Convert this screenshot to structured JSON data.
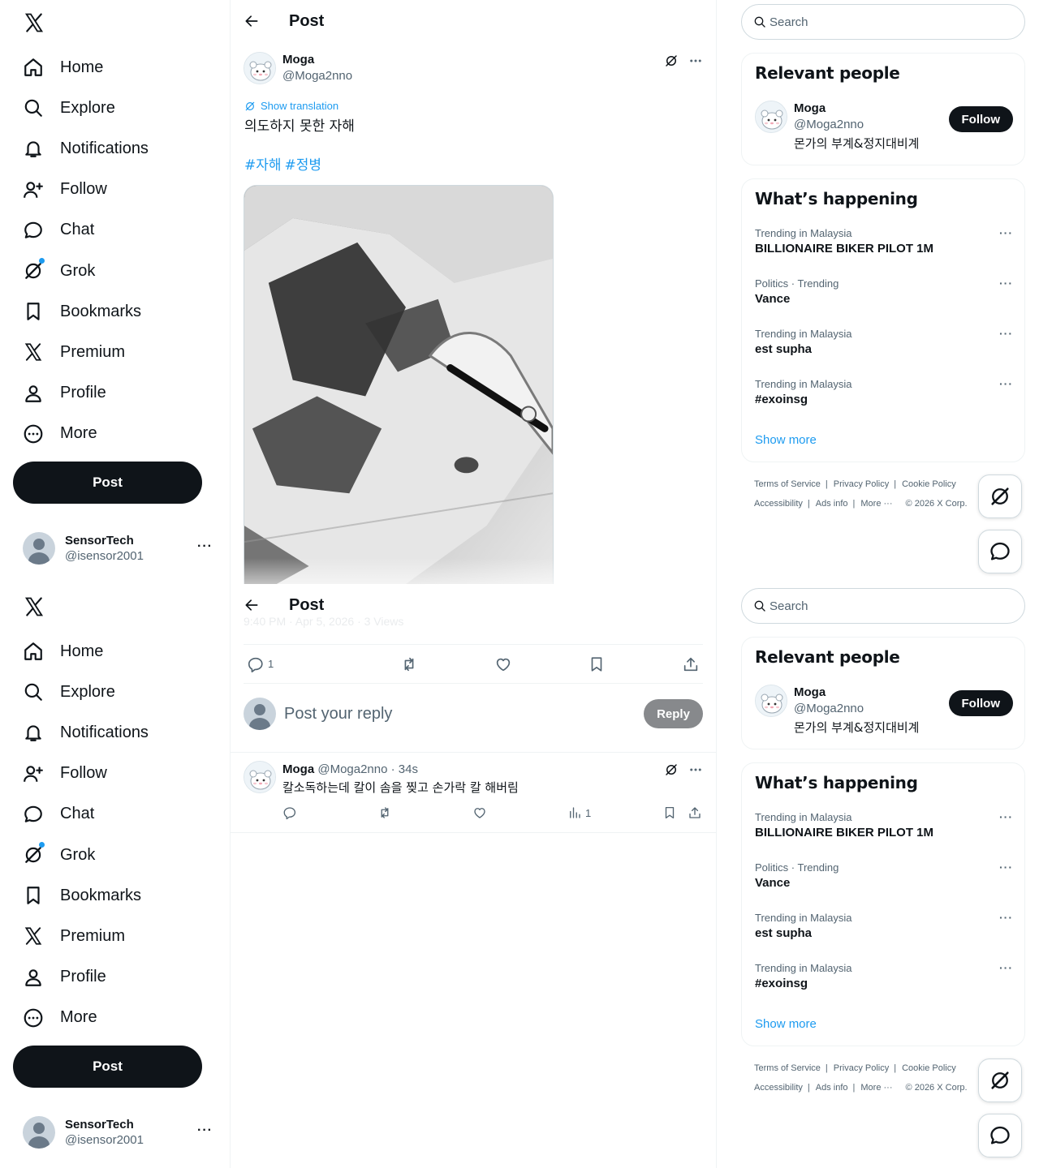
{
  "nav": {
    "items": [
      {
        "label": "Home",
        "icon": "home-icon"
      },
      {
        "label": "Explore",
        "icon": "search-icon"
      },
      {
        "label": "Notifications",
        "icon": "bell-icon"
      },
      {
        "label": "Follow",
        "icon": "person-plus-icon"
      },
      {
        "label": "Chat",
        "icon": "chat-bubble-icon"
      },
      {
        "label": "Grok",
        "icon": "grok-icon"
      },
      {
        "label": "Bookmarks",
        "icon": "bookmark-icon"
      },
      {
        "label": "Premium",
        "icon": "x-logo-icon"
      },
      {
        "label": "Profile",
        "icon": "person-icon"
      },
      {
        "label": "More",
        "icon": "more-circle-icon"
      }
    ],
    "post_label": "Post"
  },
  "account": {
    "name": "SensorTech",
    "handle": "@isensor2001"
  },
  "header": {
    "title": "Post"
  },
  "post": {
    "author_name": "Moga",
    "author_handle": "@Moga2nno",
    "translate_label": "Show translation",
    "text": "의도하지 못한 자해",
    "hashtags": [
      "#자해",
      "#정병"
    ],
    "meta": "9:40 PM · Apr 5, 2026 · 3 Views",
    "reply_count": "1"
  },
  "reply_box": {
    "placeholder": "Post your reply",
    "button": "Reply"
  },
  "reply": {
    "name": "Moga",
    "handle": "@Moga2nno",
    "time": "· 34s",
    "text": "칼소독하는데 칼이 솜을 찢고 손가락 칼 해버림",
    "views": "1"
  },
  "search": {
    "placeholder": "Search"
  },
  "relevant": {
    "title": "Relevant people",
    "name": "Moga",
    "handle": "@Moga2nno",
    "bio": "몬가의 부계&정지대비계",
    "follow_label": "Follow"
  },
  "happening": {
    "title": "What’s happening",
    "trends": [
      {
        "category": "Trending in Malaysia",
        "name": "BILLIONAIRE BIKER PILOT 1M"
      },
      {
        "category": "Politics · Trending",
        "name": "Vance"
      },
      {
        "category": "Trending in Malaysia",
        "name": "est supha"
      },
      {
        "category": "Trending in Malaysia",
        "name": "#exoinsg"
      }
    ],
    "show_more": "Show more"
  },
  "footer": {
    "links_row1": [
      "Terms of Service",
      "Privacy Policy",
      "Cookie Policy"
    ],
    "links_row2": [
      "Accessibility",
      "Ads info",
      "More ···",
      "© 2026 X Corp."
    ]
  },
  "colors": {
    "accent": "#1d9bf0",
    "text": "#0f1419",
    "muted": "#536471",
    "border": "#eff3f4"
  }
}
